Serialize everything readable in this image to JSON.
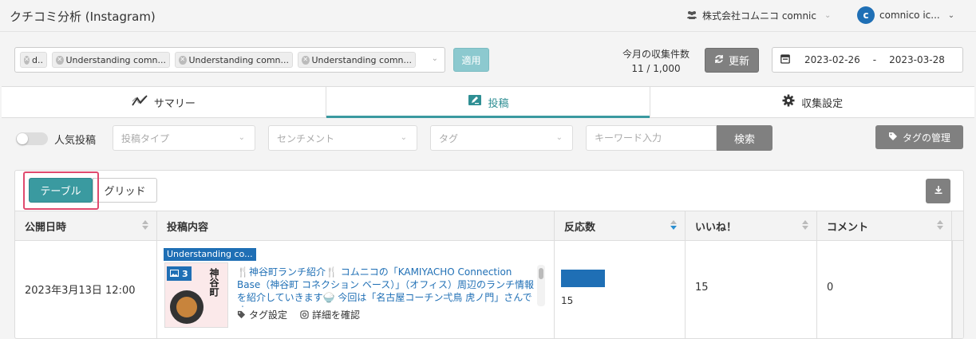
{
  "header": {
    "app_title": "クチコミ分析 (Instagram)",
    "company": "株式会社コムニコ comnic",
    "user_initial": "c",
    "user_name": "comnico ic..."
  },
  "filters": {
    "accounts": [
      "d..",
      "Understanding comn...",
      "Understanding comn...",
      "Understanding comn..."
    ],
    "apply_label": "適用",
    "collected_label": "今月の収集件数",
    "collected_value": "11 / 1,000",
    "refresh_label": "更新",
    "date_from": "2023-02-26",
    "date_separator": "-",
    "date_to": "2023-03-28"
  },
  "tabs": [
    {
      "label": "サマリー",
      "icon": "trend-icon",
      "active": false
    },
    {
      "label": "投稿",
      "icon": "edit-icon",
      "active": true
    },
    {
      "label": "収集設定",
      "icon": "gear-icon",
      "active": false
    }
  ],
  "controls": {
    "popular_label": "人気投稿",
    "post_type_placeholder": "投稿タイプ",
    "sentiment_placeholder": "センチメント",
    "tag_placeholder": "タグ",
    "keyword_placeholder": "キーワード入力",
    "search_label": "検索",
    "tag_manage_label": "タグの管理"
  },
  "view": {
    "table_label": "テーブル",
    "grid_label": "グリッド"
  },
  "table": {
    "columns": [
      "公開日時",
      "投稿内容",
      "反応数",
      "いいね！",
      "コメント"
    ],
    "rows": [
      {
        "date": "2023年3月13日 12:00",
        "account_label": "Understanding co...",
        "media_count": "3",
        "thumb_text": "神谷町",
        "content": "🍴神谷町ランチ紹介🍴 コムニコの「KAMIYACHO Connection Base（神谷町 コネクション ベース）」（オフィス）周辺のランチ情報を紹介していきます🍚 今回は「名古屋コーチン弌鳥 虎ノ門」さんです。",
        "tag_action": "タグ設定",
        "detail_action": "詳細を確認",
        "reactions": "15",
        "reaction_fraction": 1.0,
        "likes": "15",
        "comments": "0"
      }
    ]
  },
  "colors": {
    "accent": "#3a9aa0",
    "link": "#1f6fb5",
    "highlight": "#e04a6e"
  }
}
